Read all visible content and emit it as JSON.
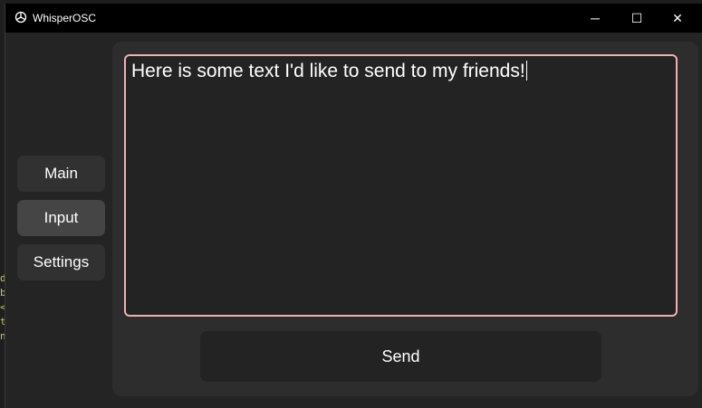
{
  "window": {
    "title": "WhisperOSC",
    "icon": "openai-logo-icon",
    "controls": {
      "minimize": "─",
      "maximize": "☐",
      "close": "✕"
    }
  },
  "sidebar": {
    "items": [
      {
        "label": "Main",
        "active": false
      },
      {
        "label": "Input",
        "active": true
      },
      {
        "label": "Settings",
        "active": false
      }
    ]
  },
  "input_panel": {
    "text": "Here is some text I'd like to send to my friends!",
    "border_color": "#f0b0b0",
    "send_label": "Send"
  },
  "background_code": "d\nb\n<\nt\nn,button"
}
